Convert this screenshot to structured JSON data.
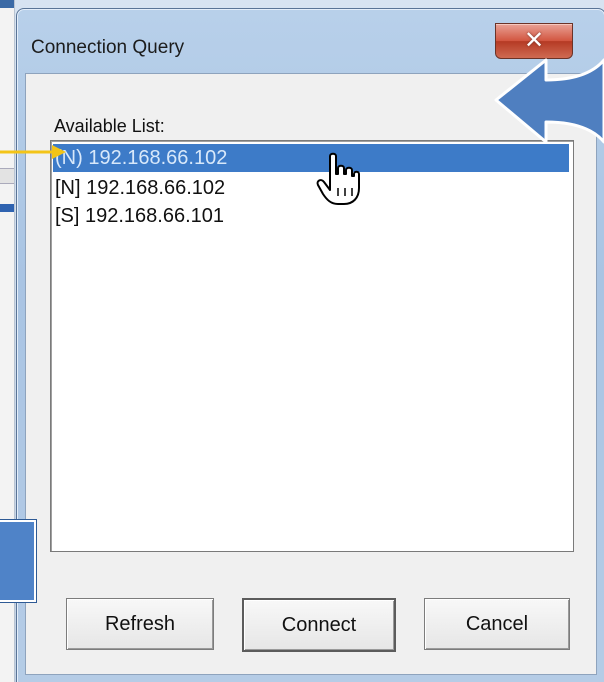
{
  "dialog": {
    "title": "Connection Query",
    "close_glyph": "✕"
  },
  "available_list": {
    "label": "Available List:",
    "items": [
      {
        "label": "(N) 192.168.66.102",
        "selected": true
      },
      {
        "label": "[N] 192.168.66.102",
        "selected": false
      },
      {
        "label": "[S] 192.168.66.101",
        "selected": false
      }
    ]
  },
  "buttons": {
    "refresh": "Refresh",
    "connect": "Connect",
    "cancel": "Cancel"
  },
  "colors": {
    "selection": "#3d7bc8",
    "annotation_arrow": "#4f7fc0",
    "pointer_yellow": "#f3c418",
    "close_red": "#c9442c"
  },
  "icons": {
    "cursor": "hand-pointer-icon",
    "arrow": "callout-arrow-icon"
  }
}
